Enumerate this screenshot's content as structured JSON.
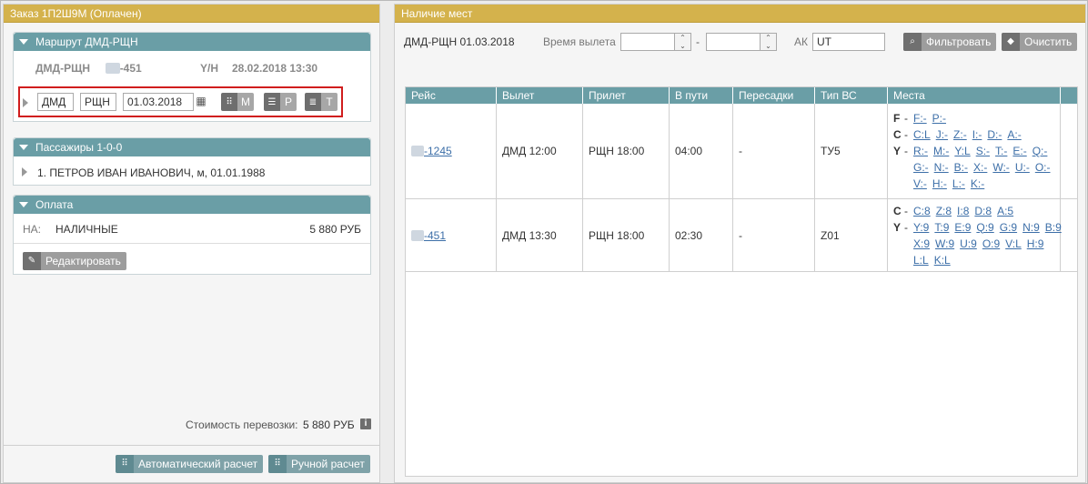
{
  "left": {
    "title": "Заказ 1П2Ш9М (Оплачен)",
    "route": {
      "header": "Маршрут ДМД-РЩН",
      "segment_route": "ДМД-РЩН",
      "segment_flight": "-451",
      "segment_class": "Y/Н",
      "segment_datetime": "28.02.2018 13:30",
      "edit": {
        "from": "ДМД",
        "to": "РЩН",
        "date": "01.03.2018",
        "btn_m": "M",
        "btn_p": "P",
        "btn_t": "T"
      }
    },
    "passengers": {
      "header": "Пассажиры 1-0-0",
      "items": [
        "1. ПЕТРОВ ИВАН ИВАНОВИЧ, м, 01.01.1988"
      ]
    },
    "payment": {
      "header": "Оплата",
      "prefix": "НА:",
      "method": "НАЛИЧНЫЕ",
      "amount": "5 880 РУБ",
      "edit_label": "Редактировать"
    },
    "cost_label": "Стоимость перевозки:",
    "cost_value": "5 880 РУБ",
    "auto_calc_label": "Автоматический расчет",
    "manual_calc_label": "Ручной расчет"
  },
  "right": {
    "title": "Наличие мест",
    "route": "ДМД-РЩН",
    "date": "01.03.2018",
    "departure_label": "Время вылета",
    "time_from": "",
    "time_to": "",
    "range_sep": "-",
    "ak_label": "АК",
    "ak_value": "UT",
    "filter_label": "Фильтровать",
    "clear_label": "Очистить",
    "columns": [
      "Рейс",
      "Вылет",
      "Прилет",
      "В пути",
      "Пересадки",
      "Тип ВС",
      "Места"
    ],
    "rows": [
      {
        "flight": "-1245",
        "departure": "ДМД 12:00",
        "arrival": "РЩН 18:00",
        "duration": "04:00",
        "transfers": "-",
        "aircraft": "ТУ5",
        "classes": [
          {
            "cls": "F",
            "codes": [
              "F:-",
              "P:-"
            ]
          },
          {
            "cls": "C",
            "codes": [
              "C:L",
              "J:-",
              "Z:-",
              "I:-",
              "D:-",
              "A:-"
            ]
          },
          {
            "cls": "Y",
            "codes": [
              "R:-",
              "M:-",
              "Y:L",
              "S:-",
              "T:-",
              "E:-",
              "Q:-",
              "G:-",
              "N:-",
              "B:-",
              "X:-",
              "W:-",
              "U:-",
              "O:-",
              "V:-",
              "H:-",
              "L:-",
              "K:-"
            ]
          }
        ]
      },
      {
        "flight": "-451",
        "departure": "ДМД 13:30",
        "arrival": "РЩН 18:00",
        "duration": "02:30",
        "transfers": "-",
        "aircraft": "Z01",
        "classes": [
          {
            "cls": "C",
            "codes": [
              "C:8",
              "Z:8",
              "I:8",
              "D:8",
              "A:5"
            ]
          },
          {
            "cls": "Y",
            "codes": [
              "Y:9",
              "T:9",
              "E:9",
              "Q:9",
              "G:9",
              "N:9",
              "B:9",
              "X:9",
              "W:9",
              "U:9",
              "O:9",
              "V:L",
              "H:9",
              "L:L",
              "K:L"
            ]
          }
        ]
      }
    ]
  }
}
